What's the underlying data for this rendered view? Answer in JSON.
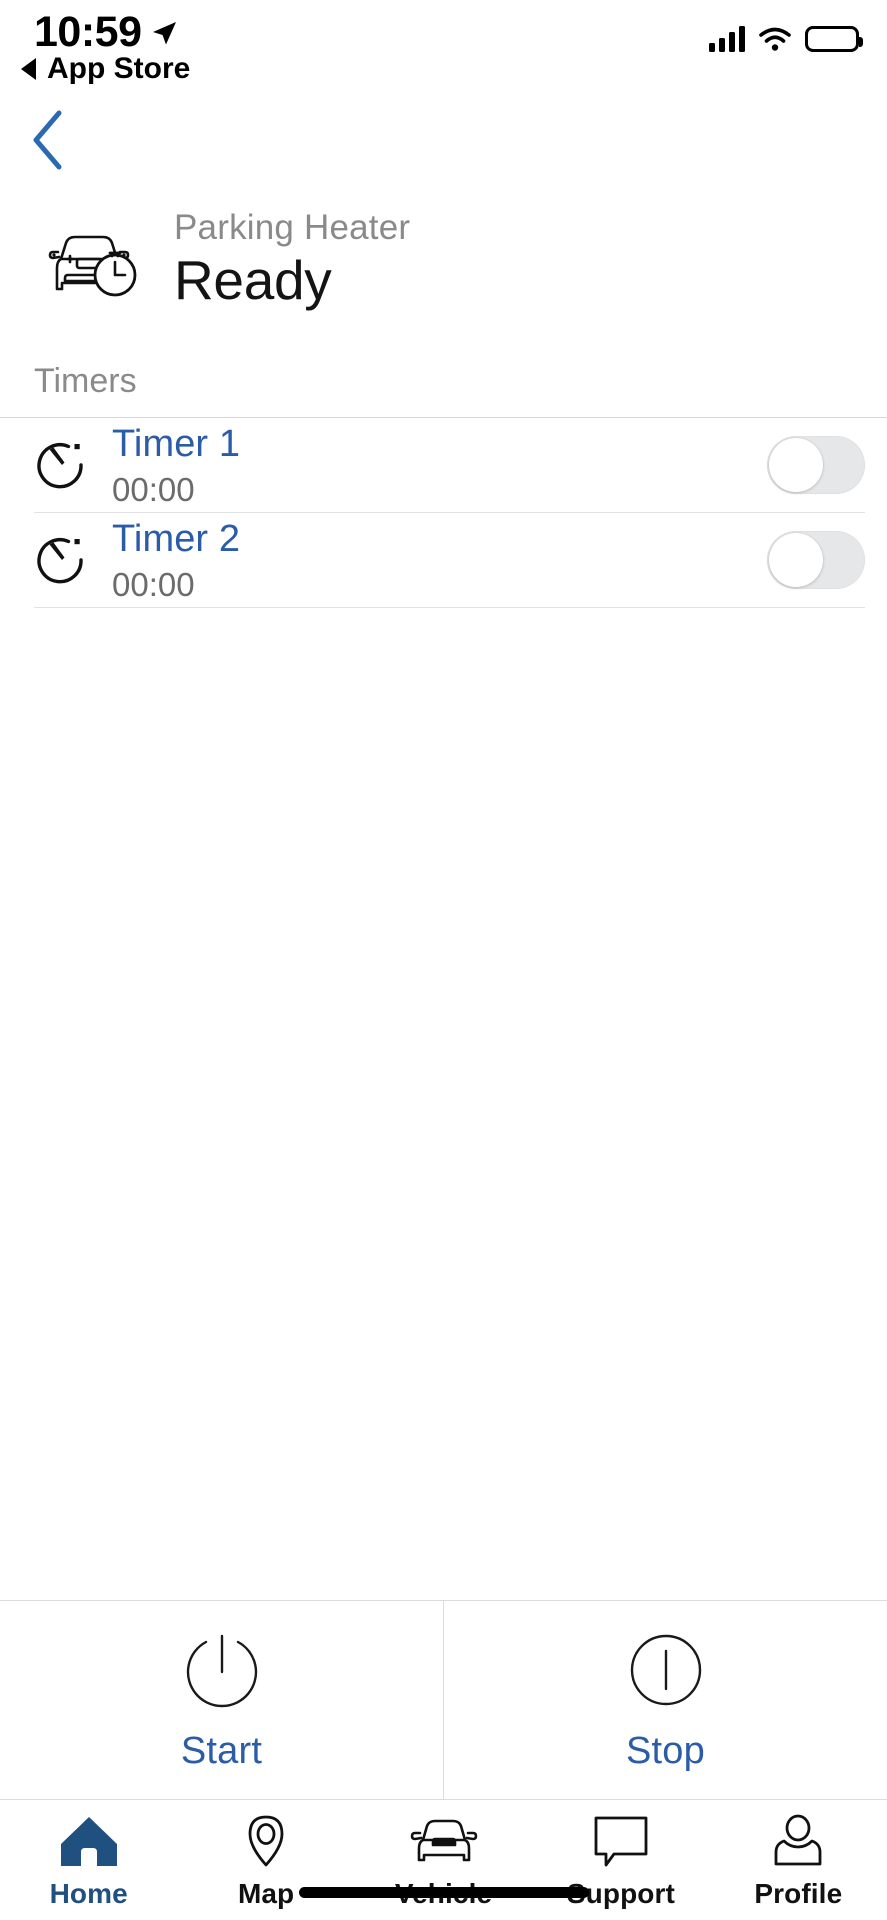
{
  "status_bar": {
    "time": "10:59",
    "return_label": "App Store",
    "location_icon": "location-arrow-icon",
    "signal_icon": "cellular-signal-icon",
    "wifi_icon": "wifi-icon",
    "battery_icon": "battery-full-icon"
  },
  "nav": {
    "back_icon": "chevron-left-icon",
    "back_color": "#2a6ab0"
  },
  "header": {
    "icon": "car-with-timer-icon",
    "subtitle": "Parking Heater",
    "title": "Ready"
  },
  "timers_section": {
    "label": "Timers",
    "items": [
      {
        "icon": "timer-icon",
        "name": "Timer 1",
        "time": "00:00",
        "enabled": false
      },
      {
        "icon": "timer-icon",
        "name": "Timer 2",
        "time": "00:00",
        "enabled": false
      }
    ]
  },
  "actions": [
    {
      "icon": "power-icon",
      "label": "Start"
    },
    {
      "icon": "stop-bar-icon",
      "label": "Stop"
    }
  ],
  "tabbar": {
    "items": [
      {
        "icon": "home-icon",
        "label": "Home",
        "active": true
      },
      {
        "icon": "map-pin-icon",
        "label": "Map",
        "active": false
      },
      {
        "icon": "car-icon",
        "label": "Vehicle",
        "active": false
      },
      {
        "icon": "speech-bubble-icon",
        "label": "Support",
        "active": false
      },
      {
        "icon": "person-icon",
        "label": "Profile",
        "active": false
      }
    ]
  },
  "colors": {
    "accent_blue": "#2a5ca8",
    "tab_active": "#205080",
    "muted_gray": "#8a8a8a",
    "divider": "#dcdcdc"
  }
}
